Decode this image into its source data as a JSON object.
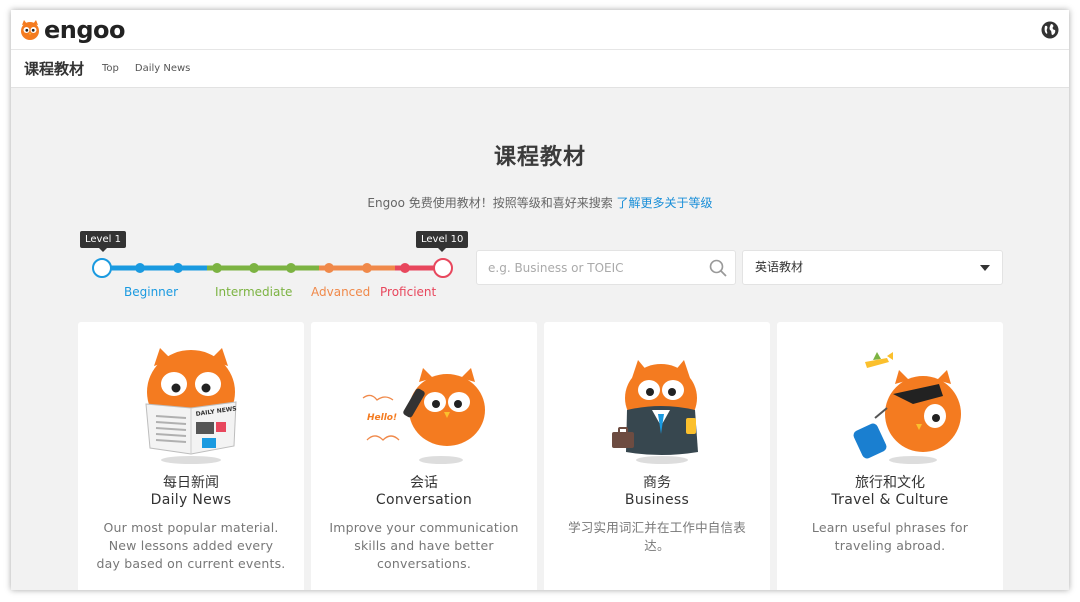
{
  "header": {
    "logo_text": "engoo"
  },
  "subnav": {
    "title": "课程教材",
    "links": [
      "Top",
      "Daily News"
    ]
  },
  "main": {
    "title": "课程教材",
    "intro_text": "Engoo 免费使用教材！按照等级和喜好来搜索 ",
    "intro_link": "了解更多关于等级"
  },
  "level_filter": {
    "min_tag": "Level 1",
    "max_tag": "Level 10",
    "min_level": 1,
    "max_level": 10,
    "groups": [
      {
        "label": "Beginner",
        "color": "#1a9ae0"
      },
      {
        "label": "Intermediate",
        "color": "#7cb342"
      },
      {
        "label": "Advanced",
        "color": "#f0894a"
      },
      {
        "label": "Proficient",
        "color": "#e8475d"
      }
    ]
  },
  "search": {
    "placeholder": "e.g. Business or TOEIC",
    "value": ""
  },
  "category_select": {
    "selected": "英语教材"
  },
  "cards": [
    {
      "title_cn": "每日新闻",
      "title_en": "Daily News",
      "description": "Our most popular material. New lessons added every day based on current events.",
      "icon": "owl-newspaper-icon"
    },
    {
      "title_cn": "会话",
      "title_en": "Conversation",
      "description": "Improve your communication skills and have better conversations.",
      "icon": "owl-phone-icon",
      "bubble": "Hello!"
    },
    {
      "title_cn": "商务",
      "title_en": "Business",
      "description": "学习实用词汇并在工作中自信表达。",
      "icon": "owl-business-icon"
    },
    {
      "title_cn": "旅行和文化",
      "title_en": "Travel & Culture",
      "description": "Learn useful phrases for traveling abroad.",
      "icon": "owl-travel-icon"
    }
  ],
  "colors": {
    "brand_orange": "#f47b20",
    "link_blue": "#1a8fd8",
    "background": "#f2f2f2"
  }
}
